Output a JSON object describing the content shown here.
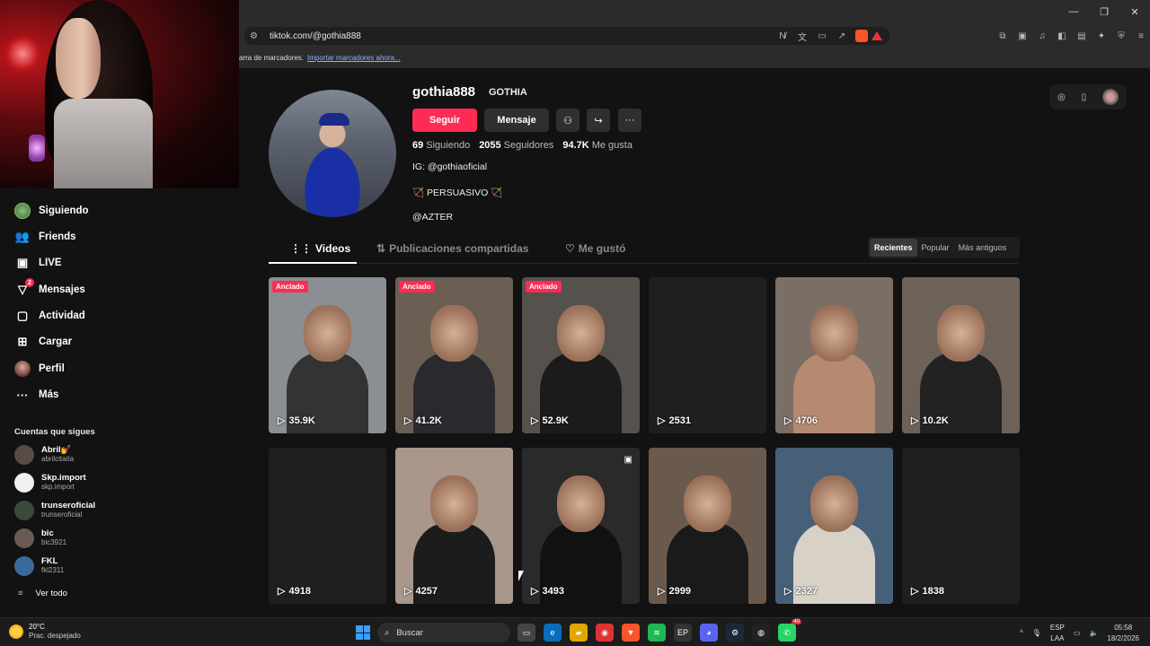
{
  "browser": {
    "url": "tiktok.com/@gothia888",
    "bookmarks_text": "arra de marcadores.",
    "bookmarks_link": "Importar marcadores ahora..."
  },
  "sidebar": {
    "nav": [
      {
        "label": "Siguiendo",
        "icon": "following-avatar-icon"
      },
      {
        "label": "Friends",
        "icon": "friends-icon"
      },
      {
        "label": "LIVE",
        "icon": "live-icon"
      },
      {
        "label": "Mensajes",
        "icon": "messages-icon",
        "badge": "2"
      },
      {
        "label": "Actividad",
        "icon": "activity-icon"
      },
      {
        "label": "Cargar",
        "icon": "upload-icon"
      },
      {
        "label": "Perfil",
        "icon": "profile-avatar-icon"
      },
      {
        "label": "Más",
        "icon": "more-icon"
      }
    ],
    "following_title": "Cuentas que sigues",
    "following": [
      {
        "name": "Abril💅",
        "handle": "abrilcitaita",
        "color": "#5a4a44"
      },
      {
        "name": "Skp.import",
        "handle": "skp.import",
        "color": "#f0f0f0"
      },
      {
        "name": "trunseroficial",
        "handle": "trunseroficial",
        "color": "#3b4a3a"
      },
      {
        "name": "bic",
        "handle": "bic3921",
        "color": "#6a5a55"
      },
      {
        "name": "FKL",
        "handle": "fkl2311",
        "color": "#3a6a9a"
      }
    ],
    "see_all": "Ver todo"
  },
  "profile": {
    "username": "gothia888",
    "nickname": "GOTHIA",
    "follow_label": "Seguir",
    "message_label": "Mensaje",
    "following_count": "69",
    "following_label": "Siguiendo",
    "followers_count": "2055",
    "followers_label": "Seguidores",
    "likes_count": "94.7K",
    "likes_label": "Me gusta",
    "bio_line1": "IG: @gothiaoficial",
    "bio_line2": "🏹 PERSUASIVO 🏹",
    "bio_line3": "@AZTER"
  },
  "tabs": [
    {
      "label": "Videos",
      "icon": "grid-icon"
    },
    {
      "label": "Publicaciones compartidas",
      "icon": "repost-icon"
    },
    {
      "label": "Me gustó",
      "icon": "heart-icon"
    }
  ],
  "sort": [
    "Recientes",
    "Popular",
    "Más antiguos"
  ],
  "pinned_label": "Anclado",
  "videos": [
    {
      "views": "35.9K",
      "pinned": true,
      "bg": "#8b8e92",
      "shirt": "#333"
    },
    {
      "views": "41.2K",
      "pinned": true,
      "bg": "#6b5e52",
      "shirt": "#2a2a2e"
    },
    {
      "views": "52.9K",
      "pinned": true,
      "bg": "#55514d",
      "shirt": "#1b1b1b"
    },
    {
      "views": "2531",
      "pinned": false,
      "bg": "#1f1f1f",
      "shirt": ""
    },
    {
      "views": "4706",
      "pinned": false,
      "bg": "#7b6e64",
      "shirt": "#b58a70"
    },
    {
      "views": "10.2K",
      "pinned": false,
      "bg": "#6e6258",
      "shirt": "#222"
    },
    {
      "views": "4918",
      "pinned": false,
      "bg": "#1f1f1f",
      "shirt": ""
    },
    {
      "views": "4257",
      "pinned": false,
      "bg": "#a8978a",
      "shirt": "#1c1c1c"
    },
    {
      "views": "3493",
      "pinned": false,
      "bg": "#2a2a2a",
      "shirt": "#111",
      "photo": true
    },
    {
      "views": "2999",
      "pinned": false,
      "bg": "#6a5a4e",
      "shirt": "#1a1a1a"
    },
    {
      "views": "2327",
      "pinned": false,
      "bg": "#46607a",
      "shirt": "#d8d2c6"
    },
    {
      "views": "1838",
      "pinned": false,
      "bg": "#1f1f1f",
      "shirt": ""
    }
  ],
  "taskbar": {
    "temp": "20°C",
    "weather": "Prac. despejado",
    "search": "Buscar",
    "lang1": "ESP",
    "lang2": "LAA",
    "time": "05:58",
    "date": "18/2/2026",
    "whatsapp_badge": "40"
  }
}
